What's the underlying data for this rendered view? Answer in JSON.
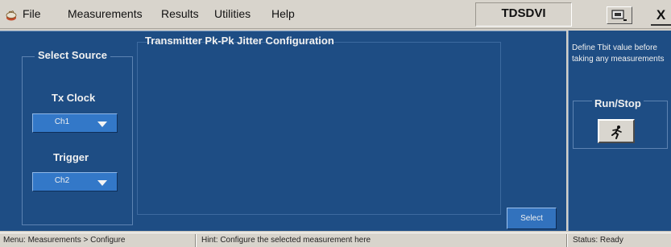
{
  "menubar": {
    "items": [
      {
        "label": "File"
      },
      {
        "label": "Measurements"
      },
      {
        "label": "Results"
      },
      {
        "label": "Utilities"
      },
      {
        "label": "Help"
      }
    ],
    "brand": "TDSDVI",
    "close_label": "X"
  },
  "main": {
    "title": "Transmitter Pk-Pk Jitter Configuration",
    "source_group_title": "Select Source",
    "tx_clock": {
      "label": "Tx Clock",
      "value": "Ch1"
    },
    "trigger": {
      "label": "Trigger",
      "value": "Ch2"
    },
    "select_label": "Select"
  },
  "right_panel": {
    "hint": "Define Tbit value before taking any measurements",
    "run_stop_label": "Run/Stop",
    "run_icon": "running-man-icon"
  },
  "statusbar": {
    "menu_path": "Menu: Measurements > Configure",
    "hint": "Hint: Configure the selected measurement here",
    "status": "Status: Ready"
  },
  "colors": {
    "panel_bg": "#1e4d84",
    "control_bg": "#3378c8",
    "chrome_bg": "#d8d4cc",
    "text_light": "#f0f0f0"
  }
}
